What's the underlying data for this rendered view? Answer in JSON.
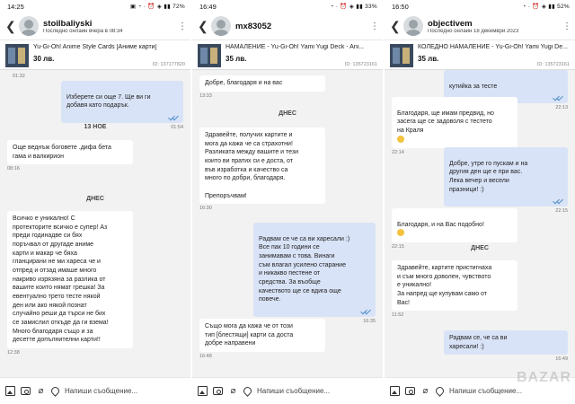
{
  "screens": [
    {
      "status_time": "14:25",
      "status_icons": "▣ ◔ ·   ⏰ ◈ ▮▮ 72%",
      "username": "stoilbaliyski",
      "user_status": "Последно онлайн вчера в 08:34",
      "product_title": "Yu-Gi-Oh! Anime Style Cards [Аниме карти]",
      "product_price": "30 лв.",
      "product_id": "ID: 137177820",
      "messages": [
        {
          "dir": "meta",
          "time": "01:32"
        },
        {
          "dir": "out",
          "text": "Изберете си още 7. Ще ви ги\nдобавя като подарък.",
          "time": "01:54"
        },
        {
          "dir": "divider",
          "text": "13 НОЕ"
        },
        {
          "dir": "in",
          "text": "Още веднъж боговете .дифа бета\nгама и валкирион",
          "time": "08:16"
        },
        {
          "dir": "divider",
          "text": "ДНЕС"
        },
        {
          "dir": "in",
          "text": "Всичко е уникално! С\nпротекторите всичко е супер! Аз\nпреди годинадве си бях\nпоръчвал от другаде аниме\nкарти и макар че бяха\nгланцирани не ми хареса че и\nотпред и отзад имаше много\nнакриво изрязяна за разлика от\nвашите които нямат грешка! За\nевентуално трето тесте някой\nден или ако някой познат\nслучайно реши да търси не бих\nсе замислил откъде да ги взема!\nМного благодаря също и за\nдесетте допълнителни карти!!",
          "time": "12:38"
        }
      ],
      "input_placeholder": "Напиши съобщение..."
    },
    {
      "status_time": "16:49",
      "status_icons": "◔ ·   ⏰ ◈ ▮▮ 33%",
      "username": "mx83052",
      "user_status": "",
      "product_title": "НАМАЛЕНИЕ - Yu-Gi-Oh! Yami Yugi Deck - Ani...",
      "product_price": "35 лв.",
      "product_id": "ID: 135723161",
      "messages": [
        {
          "dir": "in",
          "text": "Добре, благодаря и на вас",
          "time": "13:33"
        },
        {
          "dir": "divider",
          "text": "ДНЕС"
        },
        {
          "dir": "in",
          "text": "Здравейте, получих картите и\nмога да кажа че са страхотни!\nРазликата между вашите и тези\nкоито ви пратих си е доста, от\nвъв изработка и качество са\nмного по добри, благодаря.\n\nПрепоръчвам!",
          "time": "16:30"
        },
        {
          "dir": "out",
          "text": "Радвам се че са ви харесали :)\nВсе пак 10 години се\nзанимавам с това. Винаги\nсъм влагал усилено старание\nи никакво пестене от\nсредства. За въобще\nкачеството ще се вдига още\nповече.",
          "time": "16:35"
        },
        {
          "dir": "in",
          "text": "Също мога да кажа че от този\nтип [блестящи] карти са доста\nдобре направени",
          "time": "16:48"
        }
      ],
      "input_placeholder": "Напиши съобщение..."
    },
    {
      "status_time": "16:50",
      "status_icons": "◔ ·   ⏰ ◈ ▮▮ 52%",
      "username": "objectivem",
      "user_status": "Последно онлайн 18 декември 2023",
      "product_title": "КОЛЕДНО НАМАЛЕНИЕ - Yu-Gi-Oh! Yami Yugi De...",
      "product_price": "35 лв.",
      "product_id": "ID: 135723161",
      "messages": [
        {
          "dir": "out",
          "text": "кутийка за тесте",
          "time": "22:13"
        },
        {
          "dir": "in",
          "text": "Благодаря, ще имам предвид, но\nзасега ще се задоволя с тестето\nна Краля",
          "time": "22:14",
          "emoji": true
        },
        {
          "dir": "out",
          "text": "Добре, утре го пускам и на\nдругия ден ще е при вас.\nЛека вечер и весели\nпразници! :)",
          "time": "22:15"
        },
        {
          "dir": "in",
          "text": "Благодаря, и на Вас подобно!",
          "time": "22:15",
          "emoji": true
        },
        {
          "dir": "divider",
          "text": "ДНЕС"
        },
        {
          "dir": "in",
          "text": "Здравейте, картите пристигнаха\nи съм много доволен, чувството\nе уникално!\nЗа напред ще купувам само от\nВас!",
          "time": "11:52"
        },
        {
          "dir": "out",
          "text": "Радвам се, че са ви\nхаресали! :)",
          "time": "16:49"
        }
      ],
      "input_placeholder": "Напиши съобщение...",
      "watermark": "BAZAR"
    }
  ]
}
